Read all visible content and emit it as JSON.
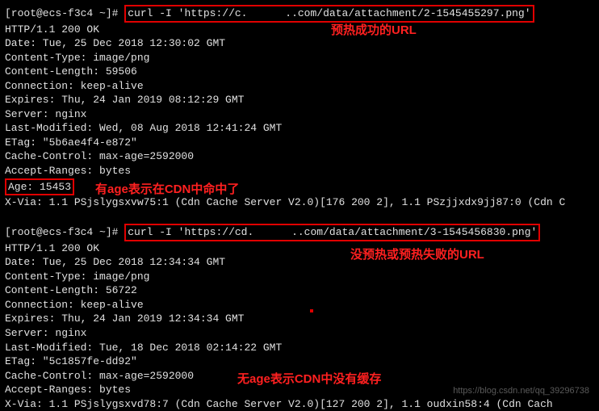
{
  "request1": {
    "prompt": "[root@ecs-f3c4 ~]#",
    "cmd": "curl -I 'https://c.      ..com/data/attachment/2-1545455297.png'",
    "http": "HTTP/1.1 200 OK",
    "date": "Date: Tue, 25 Dec 2018 12:30:02 GMT",
    "ctype": "Content-Type: image/png",
    "clen": "Content-Length: 59506",
    "conn": "Connection: keep-alive",
    "exp": "Expires: Thu, 24 Jan 2019 08:12:29 GMT",
    "server": "Server: nginx",
    "lastmod": "Last-Modified: Wed, 08 Aug 2018 12:41:24 GMT",
    "etag": "ETag: \"5b6ae4f4-e872\"",
    "cache": "Cache-Control: max-age=2592000",
    "accept": "Accept-Ranges: bytes",
    "age": "Age: 15453",
    "xvia": "X-Via: 1.1 PSjslygsxvw75:1 (Cdn Cache Server V2.0)[176 200 2], 1.1 PSzjjxdx9jj87:0 (Cdn C"
  },
  "request2": {
    "prompt": "[root@ecs-f3c4 ~]#",
    "cmd": "curl -I 'https://cd.      ..com/data/attachment/3-1545456830.png'",
    "http": "HTTP/1.1 200 OK",
    "date": "Date: Tue, 25 Dec 2018 12:34:34 GMT",
    "ctype": "Content-Type: image/png",
    "clen": "Content-Length: 56722",
    "conn": "Connection: keep-alive",
    "exp": "Expires: Thu, 24 Jan 2019 12:34:34 GMT",
    "server": "Server: nginx",
    "lastmod": "Last-Modified: Tue, 18 Dec 2018 02:14:22 GMT",
    "etag": "ETag: \"5c1857fe-dd92\"",
    "cache": "Cache-Control: max-age=2592000",
    "accept": "Accept-Ranges: bytes",
    "xvia": "X-Via: 1.1 PSjslygsxvd78:7 (Cdn Cache Server V2.0)[127 200 2], 1.1 oudxin58:4 (Cdn Cach"
  },
  "annotations": {
    "a1": "预热成功的URL",
    "a2": "有age表示在CDN中命中了",
    "a3": "没预热或预热失败的URL",
    "a4": "无age表示CDN中没有缓存"
  },
  "watermark": "https://blog.csdn.net/qq_39296738"
}
